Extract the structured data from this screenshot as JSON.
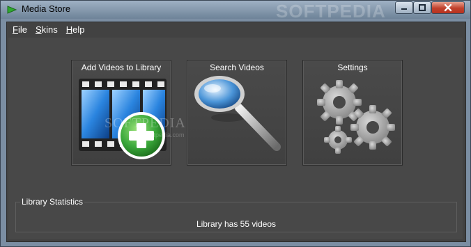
{
  "window": {
    "title": "Media Store",
    "watermark": "SOFTPEDIA"
  },
  "menu": {
    "items": [
      "File",
      "Skins",
      "Help"
    ]
  },
  "tiles": [
    {
      "label": "Add Videos to Library",
      "icon": "film-add-icon"
    },
    {
      "label": "Search Videos",
      "icon": "magnifier-icon"
    },
    {
      "label": "Settings",
      "icon": "gears-icon"
    }
  ],
  "watermark_center": {
    "text": "SOFTPEDIA",
    "sub": "www.softpedia.com"
  },
  "stats": {
    "legend": "Library Statistics",
    "text": "Library has 55 videos"
  },
  "colors": {
    "titlebar": "#7b8ea3",
    "background": "#424242",
    "close_button": "#c0402b",
    "add_green": "#3aa83a",
    "film_blue": "#3b8fe0"
  }
}
